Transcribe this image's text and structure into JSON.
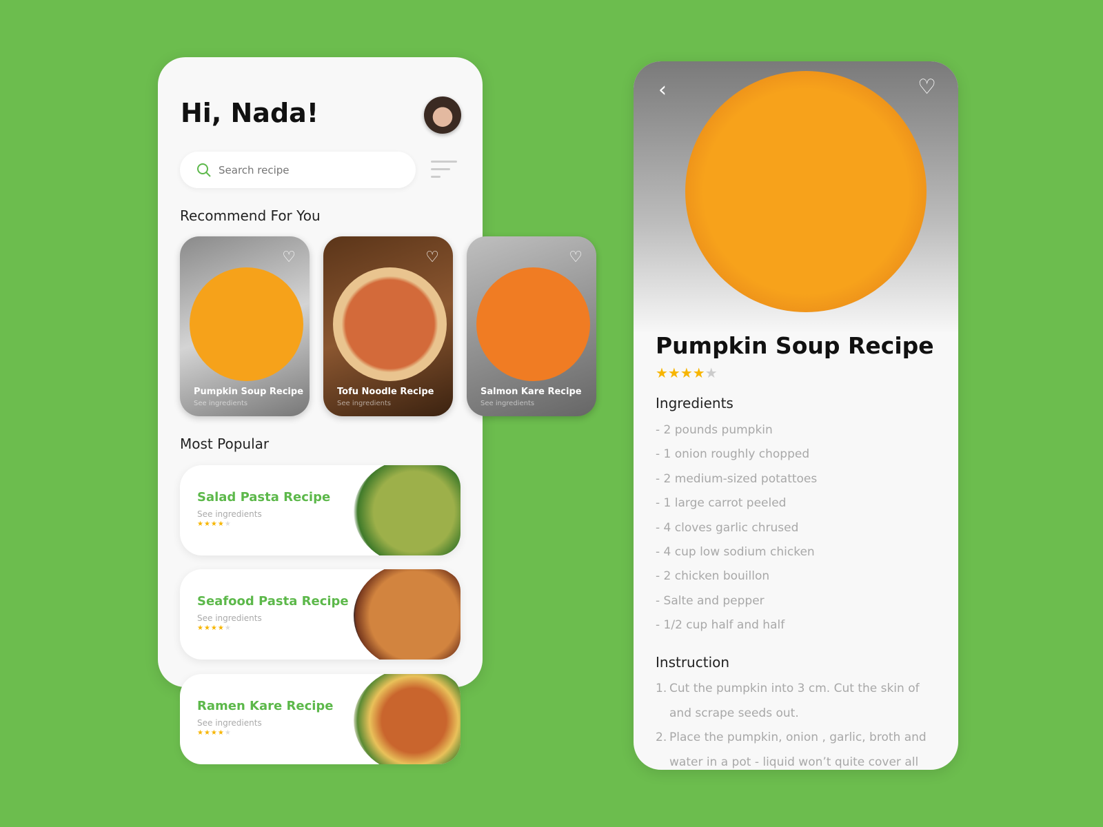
{
  "colors": {
    "background": "#6cbd4e",
    "accent": "#5cb84a",
    "star": "#f7b500"
  },
  "home": {
    "greeting": "Hi, Nada!",
    "search": {
      "placeholder": "Search recipe",
      "icon": "search-icon"
    },
    "recommend_title": "Recommend For You",
    "recommend": [
      {
        "title": "Pumpkin Soup Recipe",
        "subtitle": "See ingredients"
      },
      {
        "title": "Tofu Noodle Recipe",
        "subtitle": "See ingredients"
      },
      {
        "title": "Salmon Kare Recipe",
        "subtitle": "See ingredients"
      }
    ],
    "popular_title": "Most Popular",
    "popular": [
      {
        "title": "Salad Pasta Recipe",
        "subtitle": "See ingredients",
        "rating": 4
      },
      {
        "title": "Seafood Pasta Recipe",
        "subtitle": "See ingredients",
        "rating": 4
      },
      {
        "title": "Ramen Kare Recipe",
        "subtitle": "See ingredients",
        "rating": 4
      }
    ]
  },
  "detail": {
    "title": "Pumpkin Soup Recipe",
    "rating": 4,
    "ingredients_title": "Ingredients",
    "ingredients": [
      "- 2 pounds pumpkin",
      "- 1 onion roughly chopped",
      "- 2 medium-sized potattoes",
      "- 1 large carrot peeled",
      "- 4 cloves garlic chrused",
      "- 4 cup low sodium chicken",
      "- 2 chicken bouillon",
      "- Salte and pepper",
      "- 1/2 cup half and half"
    ],
    "instruction_title": "Instruction",
    "instructions": [
      {
        "num": "1.",
        "text": "Cut the pumpkin into 3 cm. Cut the skin of and scrape seeds out."
      },
      {
        "num": "2.",
        "text": "Place the pumpkin, onion , garlic, broth and water in a pot - liquid won’t quite cover all"
      }
    ]
  }
}
